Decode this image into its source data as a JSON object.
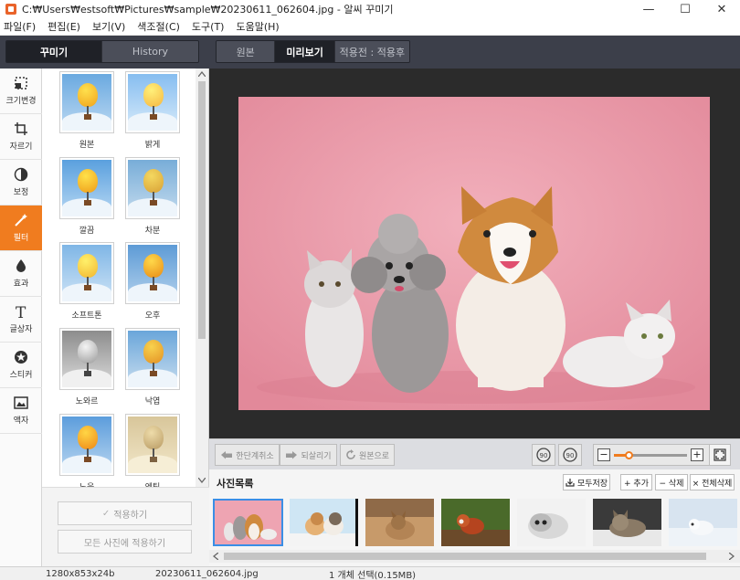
{
  "window": {
    "title": "C:₩Users₩estsoft₩Pictures₩sample₩20230611_062604.jpg - 알씨 꾸미기",
    "min_glyph": "—",
    "max_glyph": "☐",
    "close_glyph": "✕"
  },
  "menu": [
    "파일(F)",
    "편집(E)",
    "보기(V)",
    "색조절(C)",
    "도구(T)",
    "도움말(H)"
  ],
  "top_tabs": {
    "left": [
      {
        "label": "꾸미기",
        "active": true
      },
      {
        "label": "History",
        "active": false
      }
    ],
    "view": [
      {
        "label": "원본",
        "active": false
      },
      {
        "label": "미리보기",
        "active": true
      },
      {
        "label": "적용전 : 적용후",
        "active": false
      }
    ]
  },
  "tools": [
    {
      "label": "크기변경",
      "icon": "resize-icon"
    },
    {
      "label": "자르기",
      "icon": "crop-icon"
    },
    {
      "label": "보정",
      "icon": "contrast-icon"
    },
    {
      "label": "필터",
      "icon": "magic-wand-icon",
      "active": true
    },
    {
      "label": "효과",
      "icon": "drop-icon"
    },
    {
      "label": "글상자",
      "icon": "text-icon"
    },
    {
      "label": "스티커",
      "icon": "star-icon"
    },
    {
      "label": "액자",
      "icon": "frame-icon"
    }
  ],
  "filters": [
    "원본",
    "밝게",
    "깔끔",
    "차분",
    "소프트톤",
    "오후",
    "노와르",
    "낙엽",
    "노을",
    "엔틱"
  ],
  "apply": {
    "apply_label": "적용하기",
    "apply_all_label": "모든 사진에 적용하기",
    "check": "✓"
  },
  "toolbar": {
    "undo_label": "한단계취소",
    "redo_label": "되살리기",
    "revert_label": "원본으로",
    "rotate_left": "90",
    "rotate_right": "90",
    "zoom_minus": "−",
    "zoom_plus": "+",
    "zoom_level": 0.2
  },
  "photo_list": {
    "header": "사진목록",
    "save_all_label": "모두저장",
    "add_label": "+ 추가",
    "delete_label": "− 삭제",
    "delete_all_label": "× 전체삭제"
  },
  "status": {
    "dimensions": "1280x853x24b",
    "filename": "20230611_062604.jpg",
    "selection": "1 개체 선택(0.15MB)"
  },
  "colors": {
    "accent": "#f07c1f",
    "topbar": "#3c3f4a",
    "preview_bg": "#2b2b2b"
  }
}
